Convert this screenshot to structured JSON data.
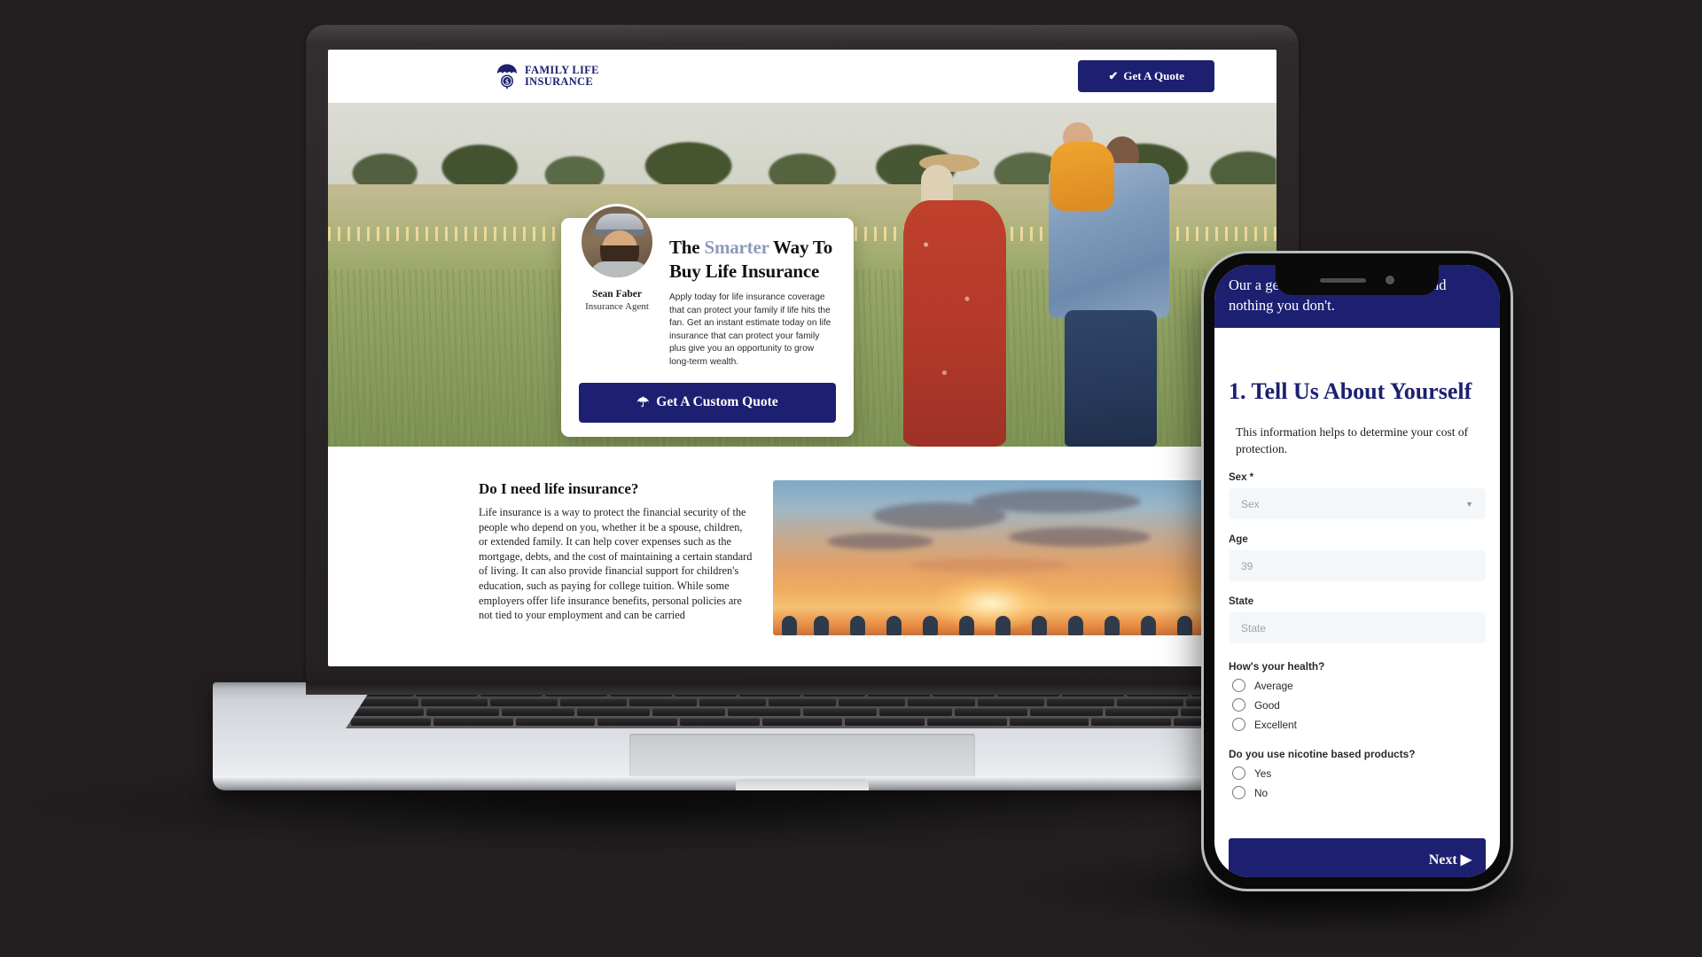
{
  "brand": {
    "name_line1": "FAMILY LIFE",
    "name_line2": "INSURANCE",
    "navy": "#1d2070",
    "accent_light": "#8d9ab8"
  },
  "desktop": {
    "header": {
      "quote_button": "Get A Quote",
      "quote_icon": "check-icon"
    },
    "hero": {
      "agent_name": "Sean Faber",
      "agent_role": "Insurance Agent",
      "title_before": "The ",
      "title_accent": "Smarter",
      "title_after": " Way To Buy Life Insurance",
      "paragraph": "Apply today for life insurance coverage that can protect your family if life hits the fan. Get an instant estimate today on life insurance that can protect your family plus give you an opportunity to grow long-term wealth.",
      "cta_label": "Get A Custom Quote",
      "cta_icon": "umbrella-icon"
    },
    "article": {
      "heading": "Do I need life insurance?",
      "body": "Life insurance is a way to protect the financial security of the people who depend on you, whether it be a spouse, children, or extended family. It can help cover expenses such as the mortgage, debts, and the cost of maintaining a certain standard of living. It can also provide financial support for children's education, such as paying for college tuition. While some employers offer life insurance benefits, personal policies are not tied to your employment and can be carried"
    }
  },
  "phone": {
    "banner": "Our a                  get the coverage you need, and nothing you don't.",
    "form_heading": "1. Tell Us About Yourself",
    "form_note": "This information helps to determine your cost of protection.",
    "fields": [
      {
        "label": "Sex *",
        "placeholder": "Sex",
        "type": "select"
      },
      {
        "label": "Age",
        "placeholder": "39",
        "type": "text"
      },
      {
        "label": "State",
        "placeholder": "State",
        "type": "text"
      }
    ],
    "questions": [
      {
        "label": "How's your health?",
        "options": [
          "Average",
          "Good",
          "Excellent"
        ]
      },
      {
        "label": "Do you use nicotine based products?",
        "options": [
          "Yes",
          "No"
        ]
      }
    ],
    "next_label": "Next",
    "next_icon": "play-triangle-icon"
  }
}
